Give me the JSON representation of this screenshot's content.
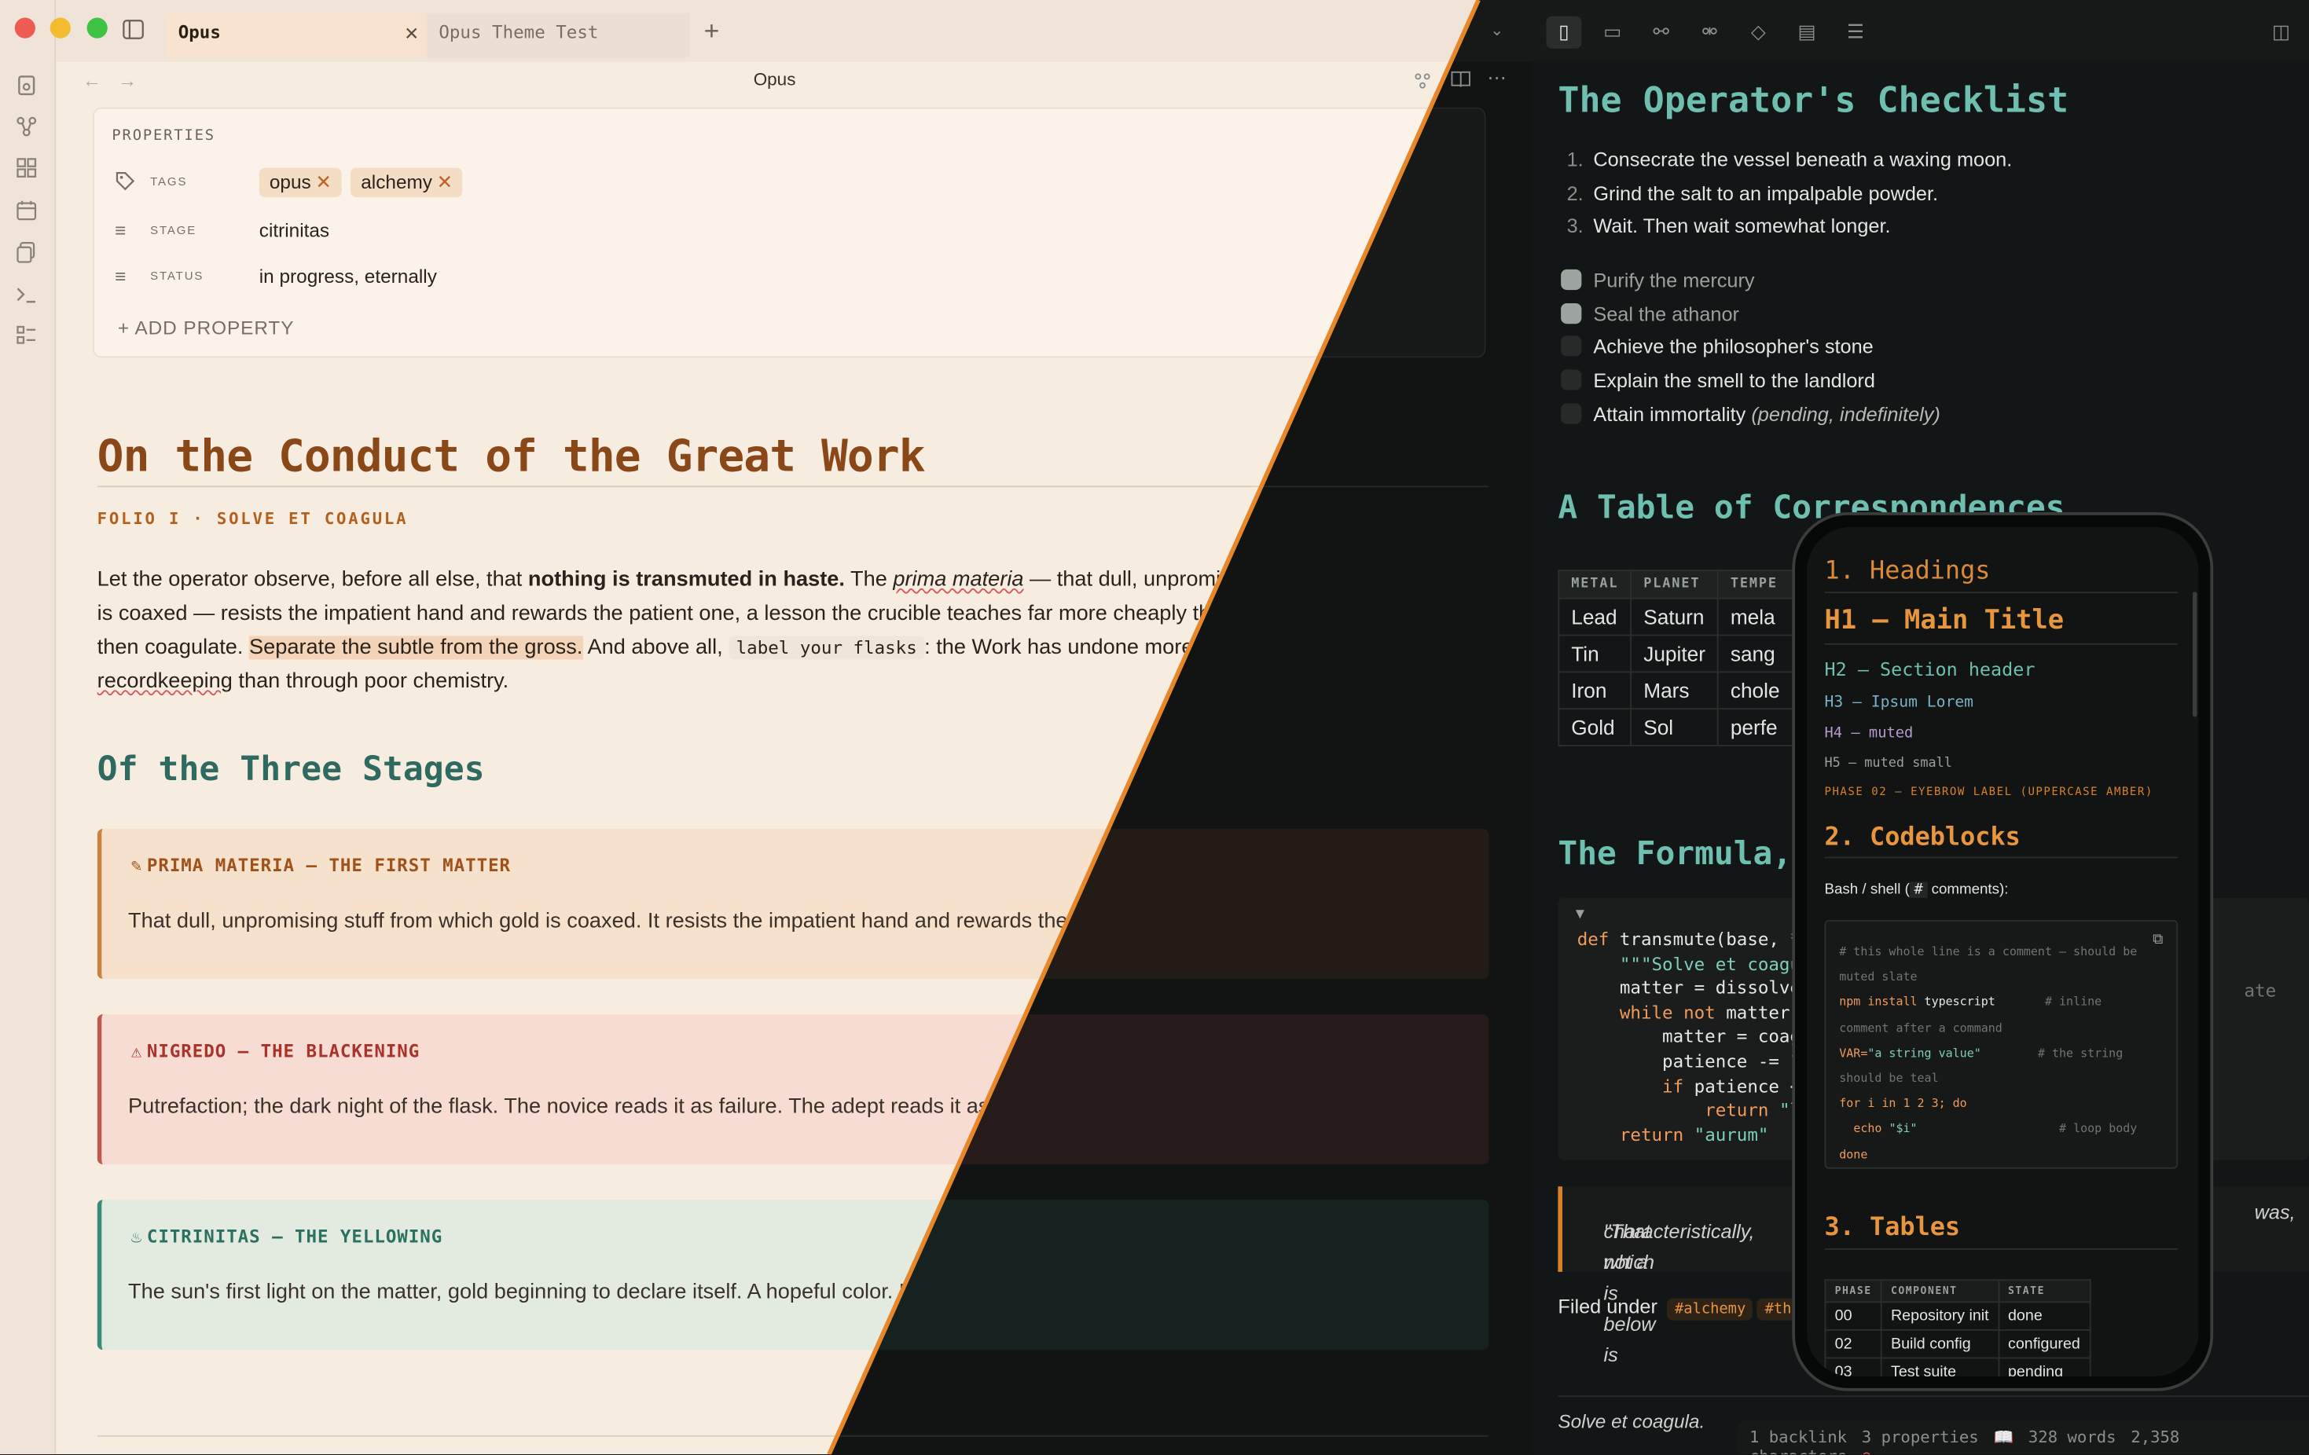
{
  "tabs": [
    {
      "label": "Opus",
      "active": true
    },
    {
      "label": "Opus Theme Test",
      "active": false
    }
  ],
  "note_title": "Opus",
  "properties": {
    "heading": "PROPERTIES",
    "tags_key": "TAGS",
    "tags": [
      "opus",
      "alchemy"
    ],
    "stage_key": "STAGE",
    "stage_value": "citrinitas",
    "status_key": "STATUS",
    "status_value": "in progress, eternally",
    "add_label": "ADD PROPERTY"
  },
  "doc": {
    "h1": "On the Conduct of the Great Work",
    "eyebrow": "FOLIO I · SOLVE ET COAGULA",
    "para": {
      "p1": "Let the operator observe, before all else, that ",
      "bold": "nothing is transmuted in haste.",
      "p2": " The ",
      "italic": "prima materia",
      "p3": " — that dull, unpromising stuff from which gold is coaxed — resists the impatient hand and rewards the patient one, a lesson the crucible teaches far more cheaply than a physician. Dissolve, then coagulate. ",
      "highlight": "Separate the subtle from the gross.",
      "p4": " And above all, ",
      "code": "label your flasks",
      "p5": ": the Work has undone more sages through poor ",
      "misspelled": "recordkeeping",
      "p6": " than through poor chemistry."
    },
    "h2": "Of the Three Stages",
    "callouts": [
      {
        "title": "PRIMA MATERIA — THE FIRST MATTER",
        "body": "That dull, unpromising stuff from which gold is coaxed. It resists the impatient hand and rewards the patient one.",
        "icon": "pencil-icon"
      },
      {
        "title": "NIGREDO — THE BLACKENING",
        "body": "Putrefaction; the dark night of the flask. The novice reads it as failure. The adept reads it as Tuesday.",
        "icon": "warning-icon"
      },
      {
        "title": "CITRINITAS — THE YELLOWING",
        "body": "The sun's first light on the matter, gold beginning to declare itself. A hopeful color. Do not trust it completely.",
        "icon": "flame-icon"
      }
    ]
  },
  "dark": {
    "h1": "The Operator's Checklist",
    "ordered": [
      "Consecrate the vessel beneath a waxing moon.",
      "Grind the salt to an impalpable powder.",
      "Wait. Then wait somewhat longer."
    ],
    "tasks": [
      {
        "text": "Purify the mercury",
        "done": true
      },
      {
        "text": "Seal the athanor",
        "done": true
      },
      {
        "text": "Achieve the philosopher's stone",
        "done": false
      },
      {
        "text": "Explain the smell to the landlord",
        "done": false
      },
      {
        "text": "Attain immortality",
        "note": "(pending, indefinitely)",
        "done": false
      }
    ],
    "h2_table": "A Table of Correspondences",
    "table_headers": [
      "METAL",
      "PLANET",
      "TEMPE"
    ],
    "table_rows": [
      [
        "Lead",
        "Saturn",
        "mela"
      ],
      [
        "Tin",
        "Jupiter",
        "sang"
      ],
      [
        "Iron",
        "Mars",
        "chole"
      ],
      [
        "Gold",
        "Sol",
        "perfe"
      ]
    ],
    "h2_formula": "The Formula,",
    "code_lines": {
      "l1a": "def ",
      "l1b": "transmute(base, *,",
      "l2": "    \"\"\"Solve et coagul",
      "l3": "    matter = dissolve(",
      "l4a": "    while not ",
      "l4b": "matter.i",
      "l5": "        matter = coagu",
      "l6": "        patience -= 1",
      "l7a": "        if ",
      "l7b": "patience <=",
      "l8a": "            return ",
      "l8b": "\"le",
      "l9a": "    return ",
      "l9b": "\"aurum\""
    },
    "code_right_fragment": "ate",
    "quote": "\"That which is below is",
    "quote2": "characteristically, not a",
    "quote_right": "was,",
    "filed_label": "Filed under",
    "filed_tags": [
      "#alchemy",
      "#th"
    ],
    "closing": "Solve et coagula.",
    "status": {
      "backlinks": "1 backlink",
      "properties": "3 properties",
      "words": "328 words",
      "chars": "2,358 characters"
    }
  },
  "phone": {
    "s1": "1. Headings",
    "h1": "H1 — Main Title",
    "h2": "H2 — Section header",
    "h3": "H3 — Ipsum Lorem",
    "h4": "H4 — muted",
    "h5": "H5 — muted small",
    "eyebrow": "PHASE 02 — EYEBROW LABEL (UPPERCASE AMBER)",
    "s2": "2. Codeblocks",
    "code_caption_a": "Bash / shell (",
    "code_caption_hash": "#",
    "code_caption_b": " comments):",
    "s3": "3. Tables",
    "table_headers": [
      "PHASE",
      "COMPONENT",
      "STATE"
    ],
    "table_rows": [
      [
        "00",
        "Repository init",
        "done"
      ],
      [
        "02",
        "Build config",
        "configured"
      ],
      [
        "03",
        "Test suite",
        "pending"
      ]
    ]
  },
  "colors": {
    "accent_orange": "#e8862a",
    "light_bg": "#f6ece0",
    "dark_bg": "#131616",
    "teal": "#6fbfb0",
    "rust": "#8a4718"
  }
}
